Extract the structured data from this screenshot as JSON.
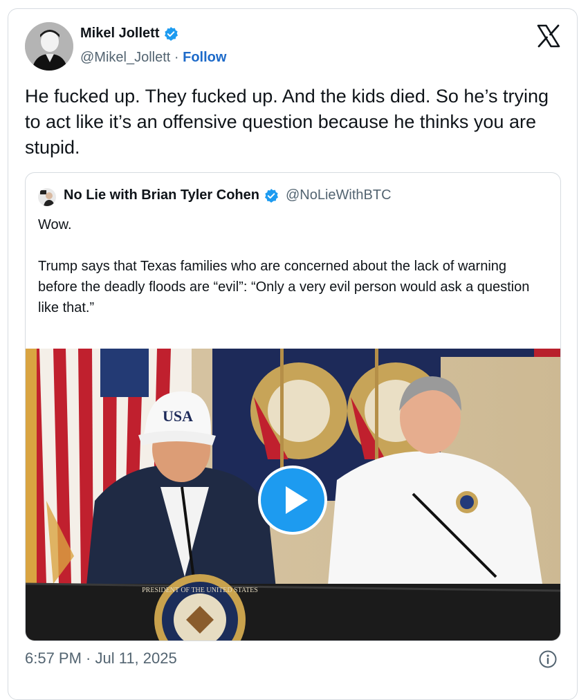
{
  "author": {
    "name": "Mikel Jollett",
    "handle": "@Mikel_Jollett",
    "separator": " · ",
    "follow_label": "Follow"
  },
  "tweet": {
    "text": "He fucked up. They fucked up. And the kids died. So he’s trying to act like it’s an offensive question because he thinks you are stupid."
  },
  "quoted": {
    "name": "No Lie with Brian Tyler Cohen",
    "handle": "@NoLieWithBTC",
    "text": "Wow.\n\nTrump says that Texas families who are concerned about the lack of warning before the deadly floods are “evil”: “Only a very evil person would ask a question like that.”",
    "video": {
      "cap_text": "USA",
      "seal_text": "PRESIDENT OF THE UNITED STATES"
    }
  },
  "timestamp": "6:57 PM · Jul 11, 2025",
  "icons": {
    "verified": "verified-badge-icon",
    "x_logo": "x-logo-icon",
    "play": "play-icon",
    "info": "info-icon"
  },
  "colors": {
    "accent_blue": "#1d9bf0",
    "follow_blue": "#1d6ac9",
    "text": "#0f1419",
    "secondary": "#536471",
    "border": "#d6dbe0"
  }
}
